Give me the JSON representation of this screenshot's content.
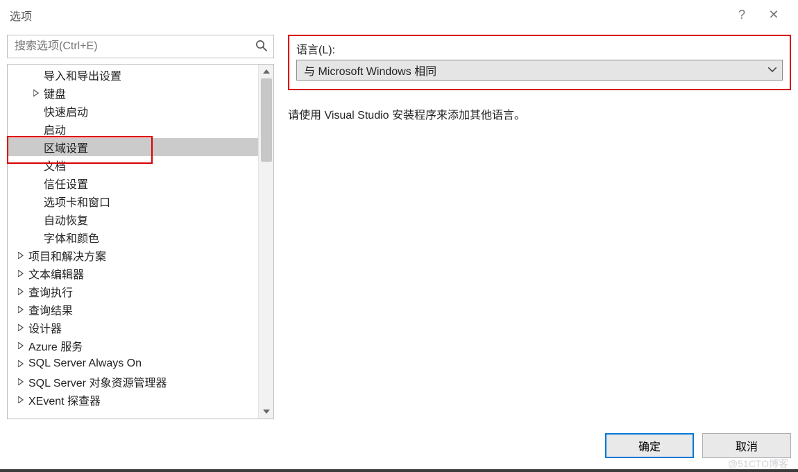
{
  "window": {
    "title": "选项",
    "help_glyph": "?",
    "close_glyph": "✕"
  },
  "search": {
    "placeholder": "搜索选项(Ctrl+E)"
  },
  "tree": {
    "items": [
      {
        "label": "导入和导出设置",
        "level": 1,
        "hasChildren": false,
        "expanded": false,
        "selected": false
      },
      {
        "label": "键盘",
        "level": 1,
        "hasChildren": true,
        "expanded": false,
        "selected": false
      },
      {
        "label": "快速启动",
        "level": 1,
        "hasChildren": false,
        "expanded": false,
        "selected": false
      },
      {
        "label": "启动",
        "level": 1,
        "hasChildren": false,
        "expanded": false,
        "selected": false
      },
      {
        "label": "区域设置",
        "level": 1,
        "hasChildren": false,
        "expanded": false,
        "selected": true
      },
      {
        "label": "文档",
        "level": 1,
        "hasChildren": false,
        "expanded": false,
        "selected": false
      },
      {
        "label": "信任设置",
        "level": 1,
        "hasChildren": false,
        "expanded": false,
        "selected": false
      },
      {
        "label": "选项卡和窗口",
        "level": 1,
        "hasChildren": false,
        "expanded": false,
        "selected": false
      },
      {
        "label": "自动恢复",
        "level": 1,
        "hasChildren": false,
        "expanded": false,
        "selected": false
      },
      {
        "label": "字体和颜色",
        "level": 1,
        "hasChildren": false,
        "expanded": false,
        "selected": false
      },
      {
        "label": "项目和解决方案",
        "level": 0,
        "hasChildren": true,
        "expanded": false,
        "selected": false
      },
      {
        "label": "文本编辑器",
        "level": 0,
        "hasChildren": true,
        "expanded": false,
        "selected": false
      },
      {
        "label": "查询执行",
        "level": 0,
        "hasChildren": true,
        "expanded": false,
        "selected": false
      },
      {
        "label": "查询结果",
        "level": 0,
        "hasChildren": true,
        "expanded": false,
        "selected": false
      },
      {
        "label": "设计器",
        "level": 0,
        "hasChildren": true,
        "expanded": false,
        "selected": false
      },
      {
        "label": "Azure 服务",
        "level": 0,
        "hasChildren": true,
        "expanded": false,
        "selected": false
      },
      {
        "label": "SQL Server Always On",
        "level": 0,
        "hasChildren": true,
        "expanded": false,
        "selected": false
      },
      {
        "label": "SQL Server 对象资源管理器",
        "level": 0,
        "hasChildren": true,
        "expanded": false,
        "selected": false
      },
      {
        "label": "XEvent 探查器",
        "level": 0,
        "hasChildren": true,
        "expanded": false,
        "selected": false
      }
    ]
  },
  "rightPanel": {
    "language_label": "语言(L):",
    "language_value": "与 Microsoft Windows 相同",
    "info_text": "请使用 Visual Studio 安装程序来添加其他语言。"
  },
  "buttons": {
    "ok": "确定",
    "cancel": "取消"
  },
  "watermark": "@51CTO博客"
}
